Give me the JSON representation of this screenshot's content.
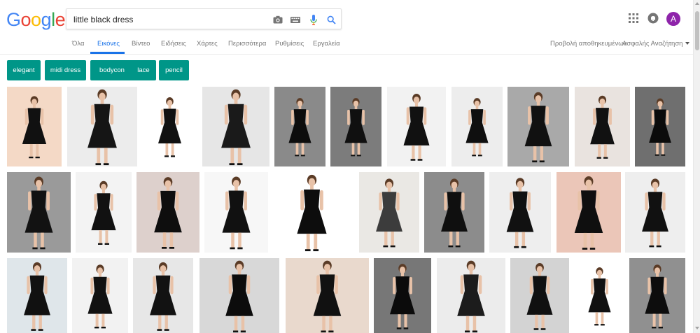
{
  "logo": {
    "letters": [
      "G",
      "o",
      "o",
      "g",
      "l",
      "e"
    ],
    "colors": [
      "#4285f4",
      "#ea4335",
      "#fbbc05",
      "#4285f4",
      "#34a853",
      "#ea4335"
    ]
  },
  "search": {
    "query": "little black dress",
    "icons": [
      "camera-icon",
      "keyboard-icon",
      "microphone-icon",
      "search-icon"
    ]
  },
  "account": {
    "initial": "A",
    "color": "#8e24aa"
  },
  "tabs": {
    "items": [
      {
        "label": "Όλα",
        "active": false
      },
      {
        "label": "Εικόνες",
        "active": true
      },
      {
        "label": "Βίντεο",
        "active": false
      },
      {
        "label": "Ειδήσεις",
        "active": false
      },
      {
        "label": "Χάρτες",
        "active": false
      },
      {
        "label": "Περισσότερα",
        "active": false
      },
      {
        "label": "Ρυθμίσεις",
        "active": false
      },
      {
        "label": "Εργαλεία",
        "active": false
      }
    ],
    "active_color": "#1a73e8",
    "saved_label": "Προβολή αποθηκευμένων",
    "safesearch_label": "Ασφαλής Αναζήτηση"
  },
  "chips": {
    "color": "#009688",
    "items": [
      "elegant",
      "midi dress",
      "bodycon",
      "lace",
      "pencil"
    ]
  },
  "thumbnails": [
    {
      "bg": "#f4d9c6",
      "dress": "#111"
    },
    {
      "bg": "#ececec",
      "dress": "#151515"
    },
    {
      "bg": "#ffffff",
      "dress": "#111"
    },
    {
      "bg": "#e6e6e6",
      "dress": "#1a1a1a"
    },
    {
      "bg": "#8a8a8a",
      "dress": "#0d0d0d"
    },
    {
      "bg": "#7c7c7c",
      "dress": "#101010"
    },
    {
      "bg": "#f2f2f2",
      "dress": "#111"
    },
    {
      "bg": "#ededed",
      "dress": "#0f0f0f"
    },
    {
      "bg": "#a9a9a9",
      "dress": "#111"
    },
    {
      "bg": "#e9e3df",
      "dress": "#111"
    },
    {
      "bg": "#6f6f6f",
      "dress": "#0b0b0b"
    },
    {
      "bg": "#9a9a9a",
      "dress": "#121212"
    },
    {
      "bg": "#f3f3f3",
      "dress": "#111"
    },
    {
      "bg": "#ddd0cc",
      "dress": "#0e0e0e"
    },
    {
      "bg": "#f7f7f7",
      "dress": "#111"
    },
    {
      "bg": "#ffffff",
      "dress": "#0d0d0d"
    },
    {
      "bg": "#eae8e4",
      "dress": "#3c3c3c"
    },
    {
      "bg": "#8c8c8c",
      "dress": "#0f0f0f"
    },
    {
      "bg": "#eeeeee",
      "dress": "#111"
    },
    {
      "bg": "#ebc6b8",
      "dress": "#0f0f0f"
    },
    {
      "bg": "#eeeeee",
      "dress": "#111"
    },
    {
      "bg": "#dfe6ea",
      "dress": "#111"
    },
    {
      "bg": "#f2f2f2",
      "dress": "#111"
    },
    {
      "bg": "#e7e7e7",
      "dress": "#121212"
    },
    {
      "bg": "#d8d8d8",
      "dress": "#0c0c0c"
    },
    {
      "bg": "#e9d9cd",
      "dress": "#111"
    },
    {
      "bg": "#777777",
      "dress": "#0b0b0b"
    },
    {
      "bg": "#ececec",
      "dress": "#1c1c1c"
    },
    {
      "bg": "#d3d3d3",
      "dress": "#101010"
    },
    {
      "bg": "#ffffff",
      "dress": "#111"
    },
    {
      "bg": "#909090",
      "dress": "#0d0d0d"
    }
  ]
}
